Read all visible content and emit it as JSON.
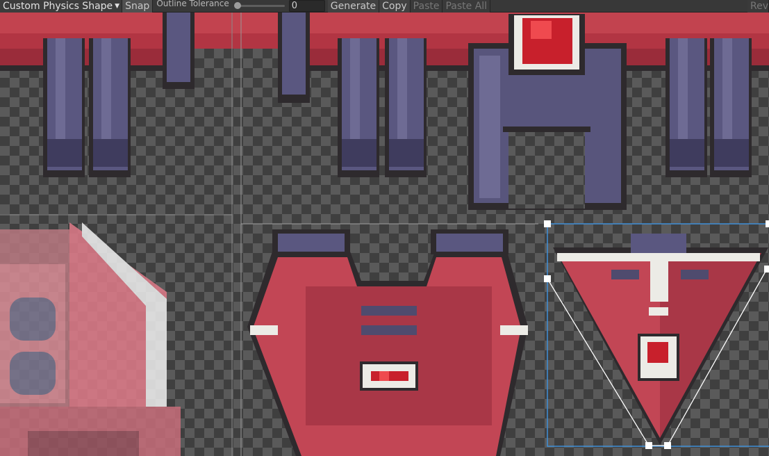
{
  "toolbar": {
    "mode_dropdown": "Custom Physics Shape",
    "snap_label": "Snap",
    "outline_tolerance_label": "Outline Tolerance",
    "outline_tolerance_value": "0",
    "generate_label": "Generate",
    "copy_label": "Copy",
    "paste_label": "Paste",
    "paste_all_label": "Paste All",
    "revert_label": "Rev"
  },
  "slider": {
    "value": 0
  },
  "colors": {
    "checker_dark": "#3e3e3e",
    "checker_light": "#5a5a5a",
    "red": "#c84a55",
    "red_dark": "#a33543",
    "metal": "#5c5a80",
    "outline": "#2e2a2d",
    "selection": "#3f8fd8"
  }
}
